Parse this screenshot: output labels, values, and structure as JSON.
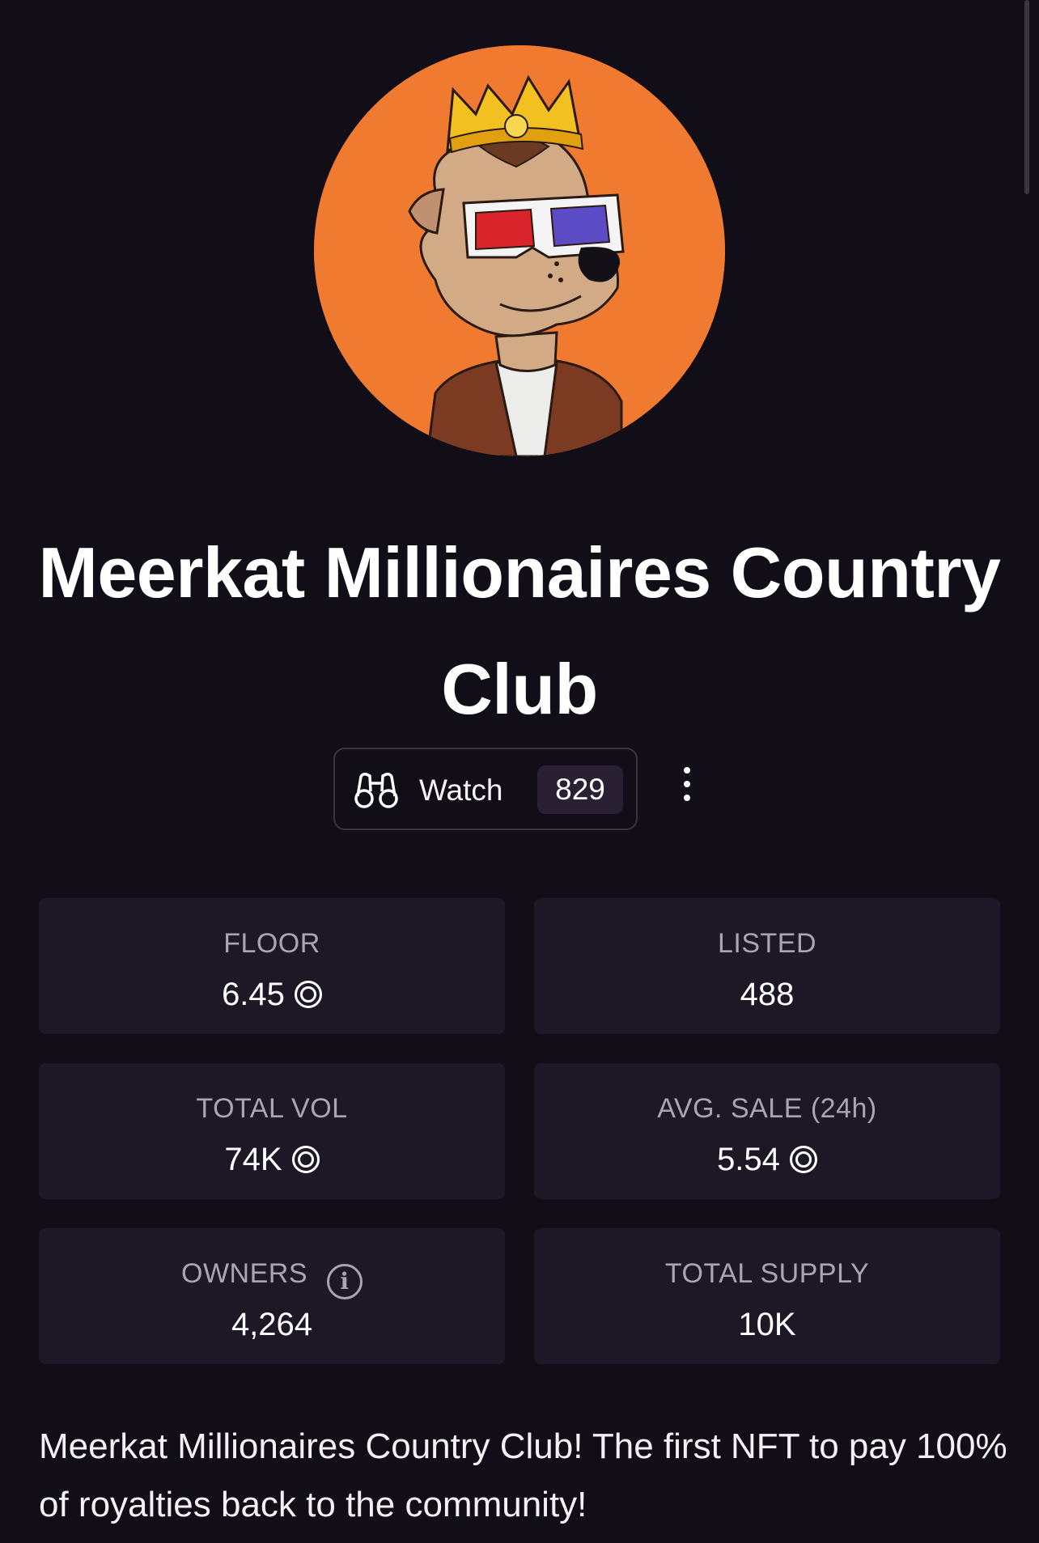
{
  "collection": {
    "name": "Meerkat Millionaires Country Club",
    "avatar_icon": "meerkat-avatar-icon",
    "avatar_bg": "#ef7a30"
  },
  "actions": {
    "watch_label": "Watch",
    "watch_count": "829",
    "watch_icon": "binoculars-icon",
    "more_icon": "more-vertical-icon"
  },
  "stats": {
    "floor": {
      "label": "FLOOR",
      "value": "6.45",
      "currency_icon": "sol-icon"
    },
    "listed": {
      "label": "LISTED",
      "value": "488"
    },
    "total_vol": {
      "label": "TOTAL VOL",
      "value": "74K",
      "currency_icon": "sol-icon"
    },
    "avg_sale": {
      "label": "AVG. SALE (24h)",
      "value": "5.54",
      "currency_icon": "sol-icon"
    },
    "owners": {
      "label": "OWNERS",
      "value": "4,264",
      "info_icon": "info-icon"
    },
    "total_supply": {
      "label": "TOTAL SUPPLY",
      "value": "10K"
    }
  },
  "description": "Meerkat Millionaires Country Club! The first NFT to pay 100% of royalties back to the community!",
  "colors": {
    "background": "#120e18",
    "card": "#1e1725",
    "badge": "#2a2033",
    "label": "#aaa5b0"
  }
}
